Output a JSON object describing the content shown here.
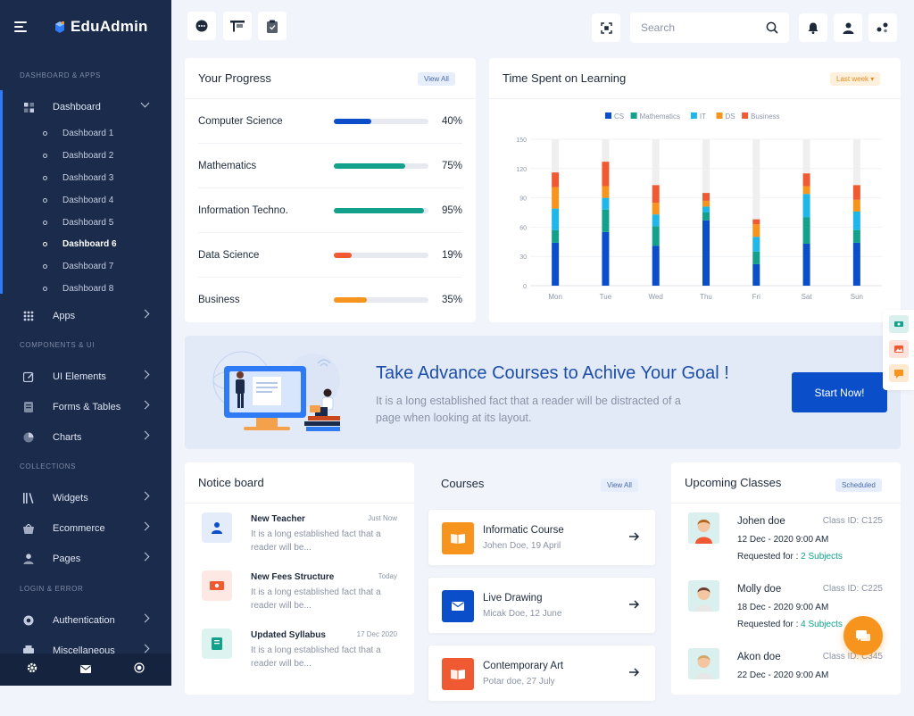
{
  "app": {
    "name": "EduAdmin"
  },
  "sidebar": {
    "sections": [
      {
        "title": "DASHBOARD & APPS"
      },
      {
        "title": "COMPONENTS & UI"
      },
      {
        "title": "COLLECTIONS"
      },
      {
        "title": "LOGIN & ERROR"
      }
    ],
    "dashboard": {
      "label": "Dashboard",
      "icon": "grid-icon"
    },
    "dashboard_items": [
      {
        "label": "Dashboard 1"
      },
      {
        "label": "Dashboard 2"
      },
      {
        "label": "Dashboard 3"
      },
      {
        "label": "Dashboard 4"
      },
      {
        "label": "Dashboard 5"
      },
      {
        "label": "Dashboard 6"
      },
      {
        "label": "Dashboard 7"
      },
      {
        "label": "Dashboard 8"
      }
    ],
    "active_dashboard_item": "Dashboard 6",
    "apps": {
      "label": "Apps",
      "icon": "apps-grid-icon"
    },
    "ui_elements": {
      "label": "UI Elements",
      "icon": "edit-icon"
    },
    "forms_tables": {
      "label": "Forms & Tables",
      "icon": "document-icon"
    },
    "charts": {
      "label": "Charts",
      "icon": "pie-chart-icon"
    },
    "widgets": {
      "label": "Widgets",
      "icon": "library-icon"
    },
    "ecommerce": {
      "label": "Ecommerce",
      "icon": "basket-icon"
    },
    "pages": {
      "label": "Pages",
      "icon": "user-icon"
    },
    "authentication": {
      "label": "Authentication",
      "icon": "target-icon"
    },
    "miscellaneous": {
      "label": "Miscellaneous",
      "icon": "printer-icon"
    }
  },
  "topbar": {
    "search_placeholder": "Search"
  },
  "progress": {
    "title": "Your Progress",
    "view_all": "View All",
    "items": [
      {
        "name": "Computer Science",
        "percent": 40,
        "pct_label": "40%",
        "color": "#0b4ec9"
      },
      {
        "name": "Mathematics",
        "percent": 75,
        "pct_label": "75%",
        "color": "#13a18c"
      },
      {
        "name": "Information Techno.",
        "percent": 95,
        "pct_label": "95%",
        "color": "#13a18c"
      },
      {
        "name": "Data Science",
        "percent": 19,
        "pct_label": "19%",
        "color": "#ef5a33"
      },
      {
        "name": "Business",
        "percent": 35,
        "pct_label": "35%",
        "color": "#f7941d"
      }
    ]
  },
  "time_spent": {
    "title": "Time Spent on Learning",
    "filter": "Last week"
  },
  "chart_data": {
    "type": "bar",
    "stacked": true,
    "categories": [
      "Mon",
      "Tue",
      "Wed",
      "Thu",
      "Fri",
      "Sat",
      "Sun"
    ],
    "series": [
      {
        "name": "CS",
        "color": "#0b4ec9",
        "values": [
          44,
          55,
          41,
          67,
          22,
          43,
          44
        ]
      },
      {
        "name": "Mathematics",
        "color": "#13a18c",
        "values": [
          13,
          23,
          20,
          8,
          13,
          27,
          13
        ]
      },
      {
        "name": "IT",
        "color": "#1fb6e9",
        "values": [
          22,
          12,
          12,
          6,
          15,
          24,
          19
        ]
      },
      {
        "name": "DS",
        "color": "#f7941d",
        "values": [
          22,
          12,
          12,
          6,
          13,
          8,
          12
        ]
      },
      {
        "name": "Business",
        "color": "#ef5a33",
        "values": [
          15,
          25,
          18,
          8,
          5,
          13,
          15
        ]
      }
    ],
    "ylim": [
      0,
      150
    ],
    "yticks": [
      0,
      30,
      60,
      90,
      120,
      150
    ],
    "legend_position": "top"
  },
  "banner": {
    "title": "Take Advance Courses to Achive Your Goal !",
    "text": "It is a long established fact that a reader will be distracted of a page when looking at its layout.",
    "button": "Start Now!"
  },
  "notice_board": {
    "title": "Notice board",
    "items": [
      {
        "title": "New Teacher",
        "time": "Just Now",
        "desc": "It is a long established fact that a reader will be...",
        "icon": "user-icon",
        "bg": "#e4ecfa",
        "fg": "#0b4ec9"
      },
      {
        "title": "New Fees Structure",
        "time": "Today",
        "desc": "It is a long established fact that a reader will be...",
        "icon": "money-icon",
        "bg": "#fde8e3",
        "fg": "#ef5a33"
      },
      {
        "title": "Updated Syllabus",
        "time": "17 Dec 2020",
        "desc": "It is a long established fact that a reader will be...",
        "icon": "book-icon",
        "bg": "#dcf3ef",
        "fg": "#13a18c"
      }
    ]
  },
  "courses": {
    "title": "Courses",
    "view_all": "View All",
    "items": [
      {
        "title": "Informatic Course",
        "sub": "Johen Doe, 19 April",
        "icon": "book-open-icon",
        "color": "#f7941d"
      },
      {
        "title": "Live Drawing",
        "sub": "Micak Doe, 12 June",
        "icon": "mail-icon",
        "color": "#0b4ec9"
      },
      {
        "title": "Contemporary Art",
        "sub": "Potar doe, 27 July",
        "icon": "book-open-icon",
        "color": "#ef5a33"
      }
    ]
  },
  "upcoming": {
    "title": "Upcoming Classes",
    "badge": "Scheduled",
    "items": [
      {
        "name": "Johen doe",
        "id": "Class ID: C125",
        "date": "12 Dec - 2020 9:00 AM",
        "req": "Requested for : ",
        "subjects": "2 Subjects"
      },
      {
        "name": "Molly doe",
        "id": "Class ID: C225",
        "date": "18 Dec - 2020 9:00 AM",
        "req": "Requested for : ",
        "subjects": "4 Subjects"
      },
      {
        "name": "Akon doe",
        "id": "Class ID: C345",
        "date": "22 Dec - 2020 9:00 AM",
        "req": "",
        "subjects": ""
      }
    ]
  }
}
